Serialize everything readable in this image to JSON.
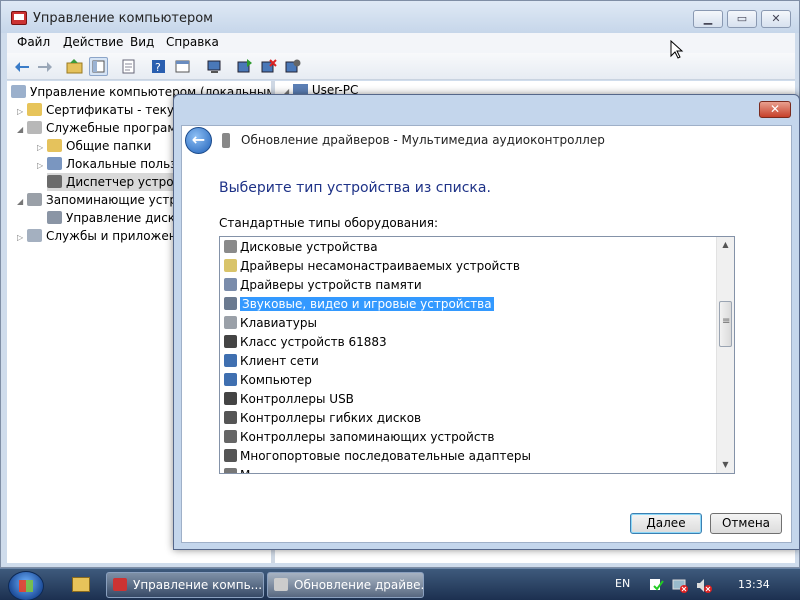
{
  "main_window": {
    "title": "Управление компьютером",
    "caption_buttons": [
      "minimize",
      "maximize",
      "close"
    ],
    "menu": [
      "Файл",
      "Действие",
      "Вид",
      "Справка"
    ],
    "toolbar_icons": [
      "back-icon",
      "forward-icon",
      "up-folder-icon",
      "show-tree-icon",
      "properties-icon",
      "help-icon",
      "view-icon",
      "scan-hardware-icon",
      "update-driver-icon",
      "uninstall-icon",
      "disable-icon"
    ],
    "tree": [
      {
        "label": "Управление компьютером (локальным)",
        "icon": "computer-management-icon"
      },
      {
        "label": "Сертификаты - текущ",
        "icon": "certificates-icon"
      },
      {
        "label": "Служебные программ",
        "icon": "tools-icon"
      },
      {
        "label": "Общие папки",
        "icon": "shared-folders-icon"
      },
      {
        "label": "Локальные пользо",
        "icon": "local-users-icon"
      },
      {
        "label": "Диспетчер устрой",
        "icon": "device-manager-icon"
      },
      {
        "label": "Запоминающие устрс",
        "icon": "storage-icon"
      },
      {
        "label": "Управление диска",
        "icon": "disk-management-icon"
      },
      {
        "label": "Службы и приложен",
        "icon": "services-icon"
      }
    ],
    "right_pane_header": "User-PC"
  },
  "dialog": {
    "title": "Обновление драйверов - Мультимедиа аудиоконтроллер",
    "heading": "Выберите тип устройства из списка.",
    "list_label": "Стандартные типы оборудования:",
    "items": [
      {
        "label": "Дисковые устройства",
        "icon": "disk-drive-icon"
      },
      {
        "label": "Драйверы несамонастраиваемых устройств",
        "icon": "non-pnp-driver-icon"
      },
      {
        "label": "Драйверы устройств памяти",
        "icon": "memory-device-icon"
      },
      {
        "label": "Звуковые, видео и игровые устройства",
        "icon": "speaker-icon",
        "selected": true
      },
      {
        "label": "Клавиатуры",
        "icon": "keyboard-icon"
      },
      {
        "label": "Класс устройств 61883",
        "icon": "firewire-icon"
      },
      {
        "label": "Клиент сети",
        "icon": "network-client-icon"
      },
      {
        "label": "Компьютер",
        "icon": "computer-icon"
      },
      {
        "label": "Контроллеры USB",
        "icon": "usb-icon"
      },
      {
        "label": "Контроллеры гибких дисков",
        "icon": "floppy-controller-icon"
      },
      {
        "label": "Контроллеры запоминающих устройств",
        "icon": "storage-controller-icon"
      },
      {
        "label": "Многопортовые последовательные адаптеры",
        "icon": "serial-adapter-icon"
      },
      {
        "label": "М...",
        "icon": "generic-device-icon"
      }
    ],
    "next_label": "Далее",
    "cancel_label": "Отмена"
  },
  "taskbar": {
    "buttons": [
      {
        "label": "Управление компь...",
        "icon": "computer-management-icon"
      },
      {
        "label": "Обновление драйве...",
        "icon": "device-icon"
      }
    ],
    "language": "EN",
    "clock": "13:34",
    "tray_icons": [
      "action-center-icon",
      "network-icon",
      "volume-muted-icon"
    ]
  },
  "colors": {
    "selection": "#3399ff",
    "heading": "#1e3287",
    "taskbar": "#1c3050",
    "titlebar": "#c6d6ea"
  }
}
